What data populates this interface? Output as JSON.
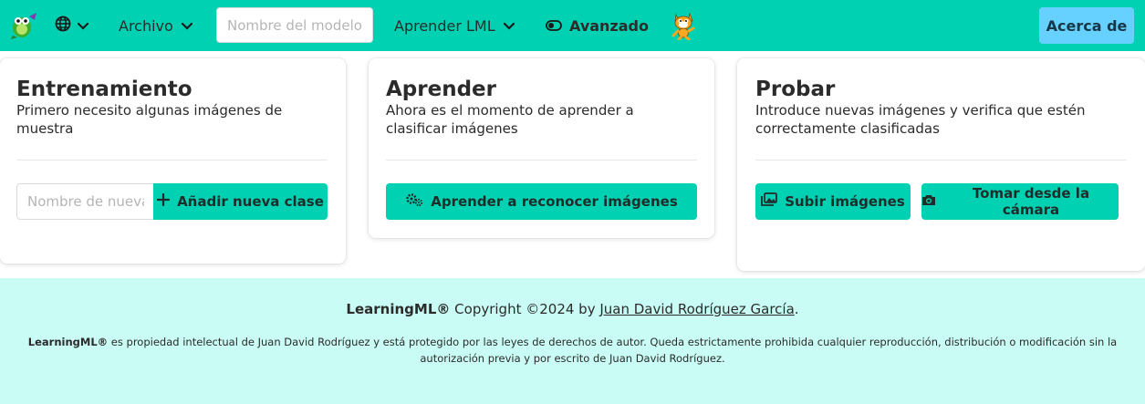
{
  "navbar": {
    "logo_icon": "learningml-logo-icon",
    "language_icon": "globe-icon",
    "menu_archivo": "Archivo",
    "model_placeholder": "Nombre del modelo",
    "menu_aprender_lml": "Aprender LML",
    "toggle_label": "Avanzado",
    "scratch_icon": "scratch-cat-icon",
    "about_label": "Acerca de",
    "bg_color": "#00d1b2",
    "about_color": "#66d1ff"
  },
  "cards": {
    "training": {
      "title": "Entrenamiento",
      "subtitle": "Primero necesito algunas imágenes de muestra",
      "class_placeholder": "Nombre de nueva clase",
      "add_class_label": "Añadir nueva clase"
    },
    "learn": {
      "title": "Aprender",
      "subtitle": "Ahora es el momento de aprender a clasificar imágenes",
      "learn_button_label": "Aprender a reconocer imágenes"
    },
    "test": {
      "title": "Probar",
      "subtitle": "Introduce nuevas imágenes y verifica que estén correctamente clasificadas",
      "upload_label": "Subir imágenes",
      "camera_label": "Tomar desde la cámara"
    }
  },
  "footer": {
    "brand": "LearningML®",
    "copyright": " Copyright ©2024 by ",
    "author": "Juan David Rodríguez García",
    "period": ".",
    "legal_brand": "LearningML®",
    "legal_text": " es propiedad intelectual de Juan David Rodríguez y está protegido por las leyes de derechos de autor. Queda estrictamente prohibida cualquier reproducción, distribución o modificación sin la autorización previa y por escrito de Juan David Rodríguez.",
    "bg_color": "#c9fcf4"
  }
}
